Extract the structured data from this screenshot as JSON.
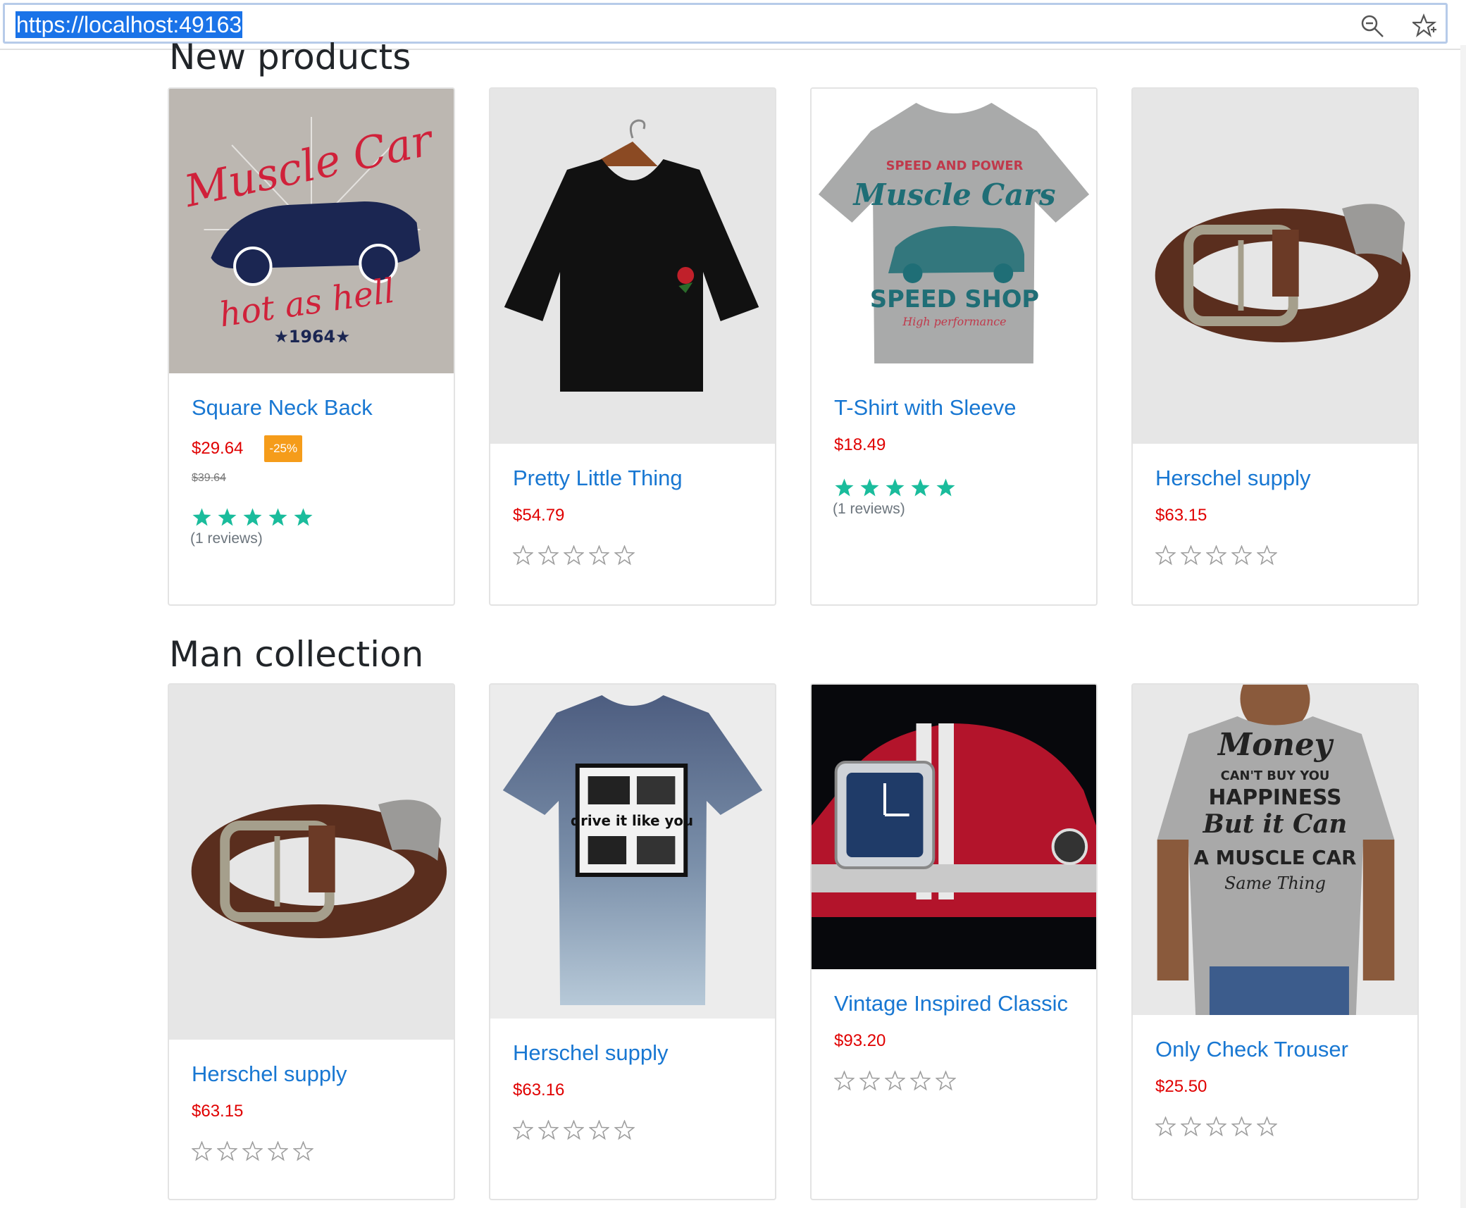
{
  "browser": {
    "url": "https://localhost:49163"
  },
  "sections": {
    "new_products": {
      "title": "New products",
      "items": [
        {
          "name": "Square Neck Back",
          "price": "$29.64",
          "badge": "-25%",
          "old_price": "$39.64",
          "rating": 5,
          "reviews": "(1 reviews)",
          "image": "muscle-car-print"
        },
        {
          "name": "Pretty Little Thing",
          "price": "$54.79",
          "rating": 0,
          "image": "black-crop-top"
        },
        {
          "name": "T-Shirt with Sleeve",
          "price": "$18.49",
          "rating": 5,
          "reviews": "(1 reviews)",
          "image": "muscle-cars-tshirt"
        },
        {
          "name": "Herschel supply",
          "price": "$63.15",
          "rating": 0,
          "image": "leather-belt"
        }
      ]
    },
    "man_collection": {
      "title": "Man collection",
      "items": [
        {
          "name": "Herschel supply",
          "price": "$63.15",
          "rating": 0,
          "image": "leather-belt"
        },
        {
          "name": "Herschel supply",
          "price": "$63.16",
          "rating": 0,
          "image": "blue-tshirt"
        },
        {
          "name": "Vintage Inspired Classic",
          "price": "$93.20",
          "rating": 0,
          "image": "watch-car"
        },
        {
          "name": "Only Check Trouser",
          "price": "$25.50",
          "rating": 0,
          "image": "money-tshirt"
        }
      ]
    }
  },
  "colors": {
    "link": "#1877d2",
    "price": "#e00000",
    "badge": "#f59c1a",
    "star_filled": "#1abc9c",
    "star_empty": "#9e9e9e"
  }
}
